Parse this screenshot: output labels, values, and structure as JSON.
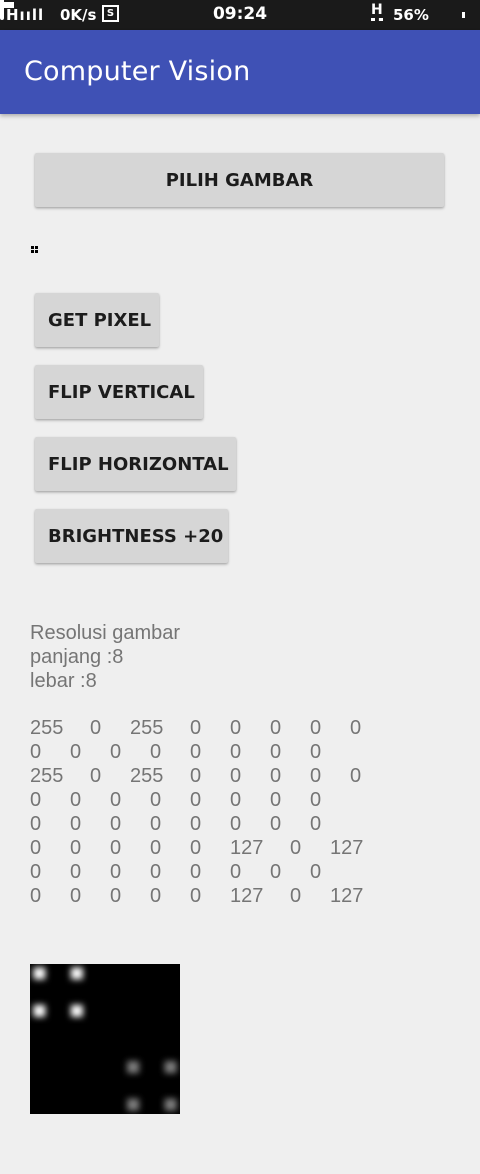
{
  "status_bar": {
    "network": "Hııll",
    "speed": "0K/s",
    "screenshot_glyph": "S",
    "time": "09:24",
    "network_type": "H",
    "battery_percent": "56%",
    "battery_level": 0.56,
    "icons": [
      "signal-icon",
      "screenshot-icon",
      "battery-icon"
    ]
  },
  "app_bar": {
    "title": "Computer Vision",
    "color": "#3f51b5"
  },
  "buttons": {
    "pick_image": "PILIH GAMBAR",
    "get_pixel": "GET PIXEL",
    "flip_vertical": "FLIP VERTICAL",
    "flip_horizontal": "FLIP HORIZONTAL",
    "brightness": "BRIGHTNESS +20"
  },
  "info": {
    "title": "Resolusi gambar",
    "length": "panjang :8",
    "width": "lebar :8"
  },
  "matrix": [
    [
      "255",
      "0",
      "255",
      "0",
      "0",
      "0",
      "0",
      "0"
    ],
    [
      "0",
      "0",
      "0",
      "0",
      "0",
      "0",
      "0",
      "0"
    ],
    [
      "255",
      "0",
      "255",
      "0",
      "0",
      "0",
      "0",
      "0"
    ],
    [
      "0",
      "0",
      "0",
      "0",
      "0",
      "0",
      "0",
      "0"
    ],
    [
      "0",
      "0",
      "0",
      "0",
      "0",
      "0",
      "0",
      "0"
    ],
    [
      "0",
      "0",
      "0",
      "0",
      "0",
      "127",
      "0",
      "127"
    ],
    [
      "0",
      "0",
      "0",
      "0",
      "0",
      "0",
      "0",
      "0"
    ],
    [
      "0",
      "0",
      "0",
      "0",
      "0",
      "127",
      "0",
      "127"
    ]
  ]
}
